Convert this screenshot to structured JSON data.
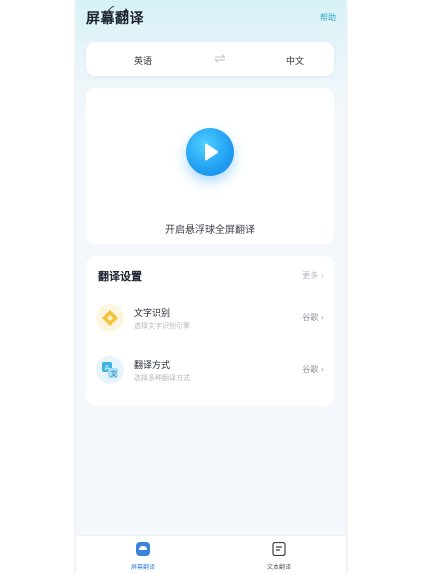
{
  "header": {
    "title": "屏幕翻译",
    "help": "帮助"
  },
  "language_bar": {
    "source": "英语",
    "target": "中文",
    "swap_icon": "swap-arrows-icon"
  },
  "main": {
    "caption": "开启悬浮球全屏翻译",
    "play_icon": "play-icon"
  },
  "settings": {
    "title": "翻译设置",
    "more": "更多",
    "items": [
      {
        "title": "文字识别",
        "desc": "选择文字识别引擎",
        "value": "谷歌",
        "icon": "diamond-icon"
      },
      {
        "title": "翻译方式",
        "desc": "选择多种翻译方式",
        "value": "谷歌",
        "icon": "translate-icon"
      }
    ]
  },
  "tabs": [
    {
      "label": "屏幕翻译",
      "icon": "screen-translate-icon",
      "active": true
    },
    {
      "label": "文本翻译",
      "icon": "text-translate-icon",
      "active": false
    }
  ],
  "colors": {
    "accent": "#1f9ef2",
    "help_link": "#2aa7c9",
    "tab_active": "#3a82d8"
  }
}
